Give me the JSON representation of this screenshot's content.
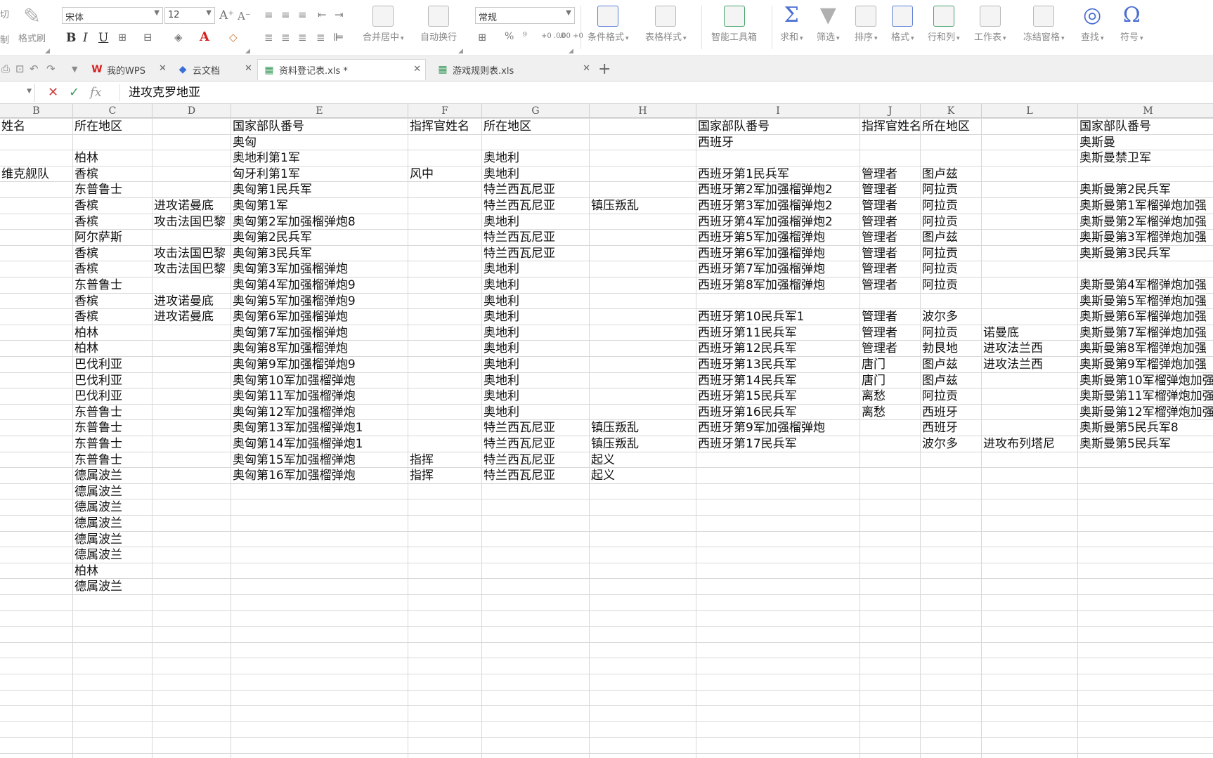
{
  "ribbon": {
    "cut_label": "切",
    "copy_label": "制",
    "format_painter_label": "格式刷",
    "font_name": "宋体",
    "font_size": "12",
    "number_format": "常规",
    "merge_center_label": "合并居中",
    "wrap_text_label": "自动换行",
    "percent_label": "%",
    "thousands_label": "⁹",
    "dec_inc_label": "+0 .00",
    "dec_dec_label": ".00 +0",
    "buttons": [
      {
        "label": "条件格式",
        "icon": "conditional-format-icon"
      },
      {
        "label": "表格样式",
        "icon": "table-style-icon"
      },
      {
        "label": "智能工具箱",
        "icon": "toolbox-icon"
      },
      {
        "label": "求和",
        "icon": "sum-icon"
      },
      {
        "label": "筛选",
        "icon": "filter-icon"
      },
      {
        "label": "排序",
        "icon": "sort-icon"
      },
      {
        "label": "格式",
        "icon": "format-icon"
      },
      {
        "label": "行和列",
        "icon": "row-col-icon"
      },
      {
        "label": "工作表",
        "icon": "worksheet-icon"
      },
      {
        "label": "冻结窗格",
        "icon": "freeze-icon"
      },
      {
        "label": "查找",
        "icon": "find-icon"
      },
      {
        "label": "符号",
        "icon": "symbol-icon"
      }
    ]
  },
  "tabs": [
    {
      "label": "我的WPS",
      "icon": "wps-logo-icon",
      "active": false
    },
    {
      "label": "云文档",
      "icon": "cloud-doc-icon",
      "active": false
    },
    {
      "label": "资料登记表.xls *",
      "icon": "sheet-file-icon",
      "active": true
    },
    {
      "label": "游戏规则表.xls",
      "icon": "sheet-file-icon",
      "active": false
    }
  ],
  "formula_bar": {
    "fx_label": "fx",
    "content": "进攻克罗地亚"
  },
  "columns": [
    "B",
    "C",
    "D",
    "E",
    "F",
    "G",
    "H",
    "I",
    "J",
    "K",
    "L",
    "M"
  ],
  "rows": [
    {
      "B": "姓名",
      "C": "所在地区",
      "E": "国家部队番号",
      "F": "指挥官姓名",
      "G": "所在地区",
      "I": "国家部队番号",
      "J": "指挥官姓名",
      "K": "所在地区",
      "M": "国家部队番号"
    },
    {
      "E": "奥匈",
      "I": "西班牙",
      "M": "奥斯曼"
    },
    {
      "C": "柏林",
      "E": "奥地利第1军",
      "G": "奥地利",
      "M": "奥斯曼禁卫军"
    },
    {
      "B": "维克舰队",
      "C": "香槟",
      "E": "匈牙利第1军",
      "F": "风中",
      "G": "奥地利",
      "I": "西班牙第1民兵军",
      "J": "管理者",
      "K": "图卢兹"
    },
    {
      "C": "东普鲁士",
      "E": "奥匈第1民兵军",
      "G": "特兰西瓦尼亚",
      "I": "西班牙第2军加强榴弹炮2",
      "J": "管理者",
      "K": "阿拉贡",
      "M": "奥斯曼第2民兵军"
    },
    {
      "C": "香槟",
      "D": "进攻诺曼底",
      "E": "奥匈第1军",
      "G": "特兰西瓦尼亚",
      "H": "镇压叛乱",
      "I": "西班牙第3军加强榴弹炮2",
      "J": "管理者",
      "K": "阿拉贡",
      "M": "奥斯曼第1军榴弹炮加强"
    },
    {
      "C": "香槟",
      "D": "攻击法国巴黎",
      "E": "奥匈第2军加强榴弹炮8",
      "G": "奥地利",
      "I": "西班牙第4军加强榴弹炮2",
      "J": "管理者",
      "K": "阿拉贡",
      "M": "奥斯曼第2军榴弹炮加强"
    },
    {
      "C": "阿尔萨斯",
      "E": "奥匈第2民兵军",
      "G": "特兰西瓦尼亚",
      "I": "西班牙第5军加强榴弹炮",
      "J": "管理者",
      "K": "图卢兹",
      "M": "奥斯曼第3军榴弹炮加强"
    },
    {
      "C": "香槟",
      "D": "攻击法国巴黎",
      "E": "奥匈第3民兵军",
      "G": "特兰西瓦尼亚",
      "I": "西班牙第6军加强榴弹炮",
      "J": "管理者",
      "K": "阿拉贡",
      "M": "奥斯曼第3民兵军"
    },
    {
      "C": "香槟",
      "D": "攻击法国巴黎",
      "E": "奥匈第3军加强榴弹炮",
      "G": "奥地利",
      "I": "西班牙第7军加强榴弹炮",
      "J": "管理者",
      "K": "阿拉贡"
    },
    {
      "C": "东普鲁士",
      "E": "奥匈第4军加强榴弹炮9",
      "G": "奥地利",
      "I": "西班牙第8军加强榴弹炮",
      "J": "管理者",
      "K": "阿拉贡",
      "M": "奥斯曼第4军榴弹炮加强"
    },
    {
      "C": "香槟",
      "D": "进攻诺曼底",
      "E": "奥匈第5军加强榴弹炮9",
      "G": "奥地利",
      "M": "奥斯曼第5军榴弹炮加强"
    },
    {
      "C": "香槟",
      "D": "进攻诺曼底",
      "E": "奥匈第6军加强榴弹炮",
      "G": "奥地利",
      "I": "西班牙第10民兵军1",
      "J": "管理者",
      "K": "波尔多",
      "M": "奥斯曼第6军榴弹炮加强"
    },
    {
      "C": "柏林",
      "E": "奥匈第7军加强榴弹炮",
      "G": "奥地利",
      "I": "西班牙第11民兵军",
      "J": "管理者",
      "K": "阿拉贡",
      "L": "诺曼底",
      "M": "奥斯曼第7军榴弹炮加强"
    },
    {
      "C": "柏林",
      "E": "奥匈第8军加强榴弹炮",
      "G": "奥地利",
      "I": "西班牙第12民兵军",
      "J": "管理者",
      "K": "勃艮地",
      "L": "进攻法兰西",
      "M": "奥斯曼第8军榴弹炮加强"
    },
    {
      "C": "巴伐利亚",
      "E": "奥匈第9军加强榴弹炮9",
      "G": "奥地利",
      "I": "西班牙第13民兵军",
      "J": "唐门",
      "K": "图卢兹",
      "L": "进攻法兰西",
      "M": "奥斯曼第9军榴弹炮加强"
    },
    {
      "C": "巴伐利亚",
      "E": "奥匈第10军加强榴弹炮",
      "G": "奥地利",
      "I": "西班牙第14民兵军",
      "J": "唐门",
      "K": "图卢兹",
      "M": "奥斯曼第10军榴弹炮加强"
    },
    {
      "C": "巴伐利亚",
      "E": "奥匈第11军加强榴弹炮",
      "G": "奥地利",
      "I": "西班牙第15民兵军",
      "J": "离愁",
      "K": "阿拉贡",
      "M": "奥斯曼第11军榴弹炮加强"
    },
    {
      "C": "东普鲁士",
      "E": "奥匈第12军加强榴弹炮",
      "G": "奥地利",
      "I": "西班牙第16民兵军",
      "J": "离愁",
      "K": "西班牙",
      "M": "奥斯曼第12军榴弹炮加强"
    },
    {
      "C": "东普鲁士",
      "E": "奥匈第13军加强榴弹炮1",
      "G": "特兰西瓦尼亚",
      "H": "镇压叛乱",
      "I": "西班牙第9军加强榴弹炮",
      "K": "西班牙",
      "M": "奥斯曼第5民兵军8"
    },
    {
      "C": "东普鲁士",
      "E": "奥匈第14军加强榴弹炮1",
      "G": "特兰西瓦尼亚",
      "H": "镇压叛乱",
      "I": "西班牙第17民兵军",
      "K": "波尔多",
      "L": "进攻布列塔尼",
      "M": "奥斯曼第5民兵军"
    },
    {
      "C": "东普鲁士",
      "E": "奥匈第15军加强榴弹炮",
      "F": "指挥",
      "G": "特兰西瓦尼亚",
      "H": "起义"
    },
    {
      "C": "德属波兰",
      "E": "奥匈第16军加强榴弹炮",
      "F": "指挥",
      "G": "特兰西瓦尼亚",
      "H": "起义"
    },
    {
      "C": "德属波兰"
    },
    {
      "C": "德属波兰"
    },
    {
      "C": "德属波兰"
    },
    {
      "C": "德属波兰"
    },
    {
      "C": "德属波兰"
    },
    {
      "C": "柏林"
    },
    {
      "C": "德属波兰"
    }
  ]
}
